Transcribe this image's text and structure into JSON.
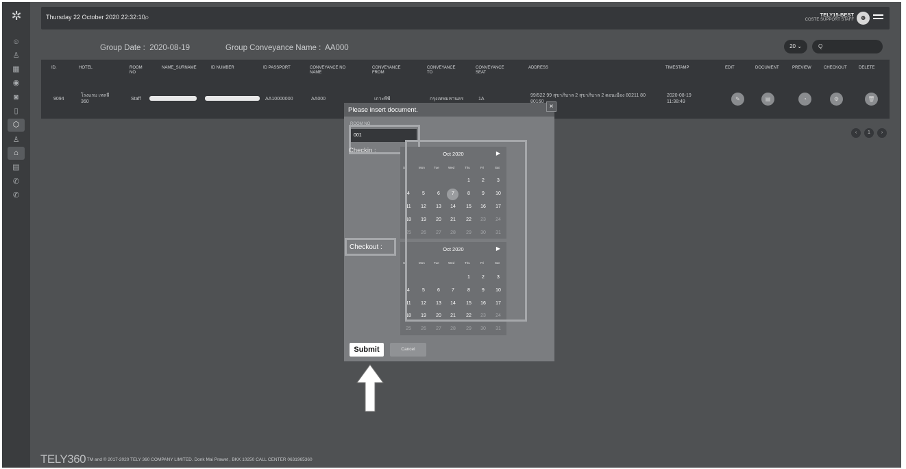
{
  "header": {
    "datetime": "Thursday 22 October 2020 22:32:10",
    "user_name": "TELY15-BEST",
    "user_role": "COSTE SUPPORT STAFF"
  },
  "group": {
    "date_label": "Group Date :",
    "date_value": "2020-08-19",
    "conveyance_label": "Group Conveyance Name :",
    "conveyance_value": "AA000"
  },
  "table_controls": {
    "page_size": "20",
    "search_placeholder": "Q"
  },
  "table": {
    "columns": [
      "ID.",
      "HOTEL",
      "ROOM NO",
      "NAME_SURNAME",
      "ID NUMBER",
      "ID PASSPORT",
      "CONVEYANCE NO NAME",
      "CONVEYANCE FROM",
      "CONVEYANCE TO",
      "CONVEYANCE SEAT",
      "ADDRESS",
      "TIMESTAMP",
      "EDIT",
      "DOCUMENT",
      "PREVIEW",
      "CHECKOUT",
      "DELETE"
    ],
    "row": {
      "id": "9094",
      "hotel": "โรงแรม เทลลี 360",
      "room_no": "Staff",
      "id_passport": "AA10000000",
      "conveyance_no_name": "AA000",
      "conveyance_from": "เกาะพีพี",
      "conveyance_to": "กรุงเทพมหานคร",
      "conveyance_seat": "1A",
      "address": "99/522 99 สุขาภิบาล 2 สุขาภิบาล 2 ดอนเมือง 80211 80 80160",
      "timestamp": "2020-08-19 11:38:49"
    }
  },
  "pagination": {
    "prev": "‹",
    "current": "1",
    "next": "›"
  },
  "modal": {
    "title": "Please insert document.",
    "close": "×",
    "room_label": "ROOM NO",
    "room_value": "001",
    "checkin_label": "Checkin :",
    "checkout_label": "Checkout :",
    "submit_label": "Submit",
    "cancel_label": "Cancel"
  },
  "calendar": {
    "month_label": "Oct 2020",
    "weekdays": [
      "Su",
      "Mon",
      "Tue",
      "Wed",
      "Thu",
      "Fri",
      "Sat"
    ],
    "checkin_selected_day": "7"
  },
  "footer": {
    "brand": "TELY360",
    "text": "TM and © 2017-2020 TELY 360 COMPANY LIMITED. Donk Mai Prawet , BKK 10250 CALL CENTER 0631965360"
  }
}
